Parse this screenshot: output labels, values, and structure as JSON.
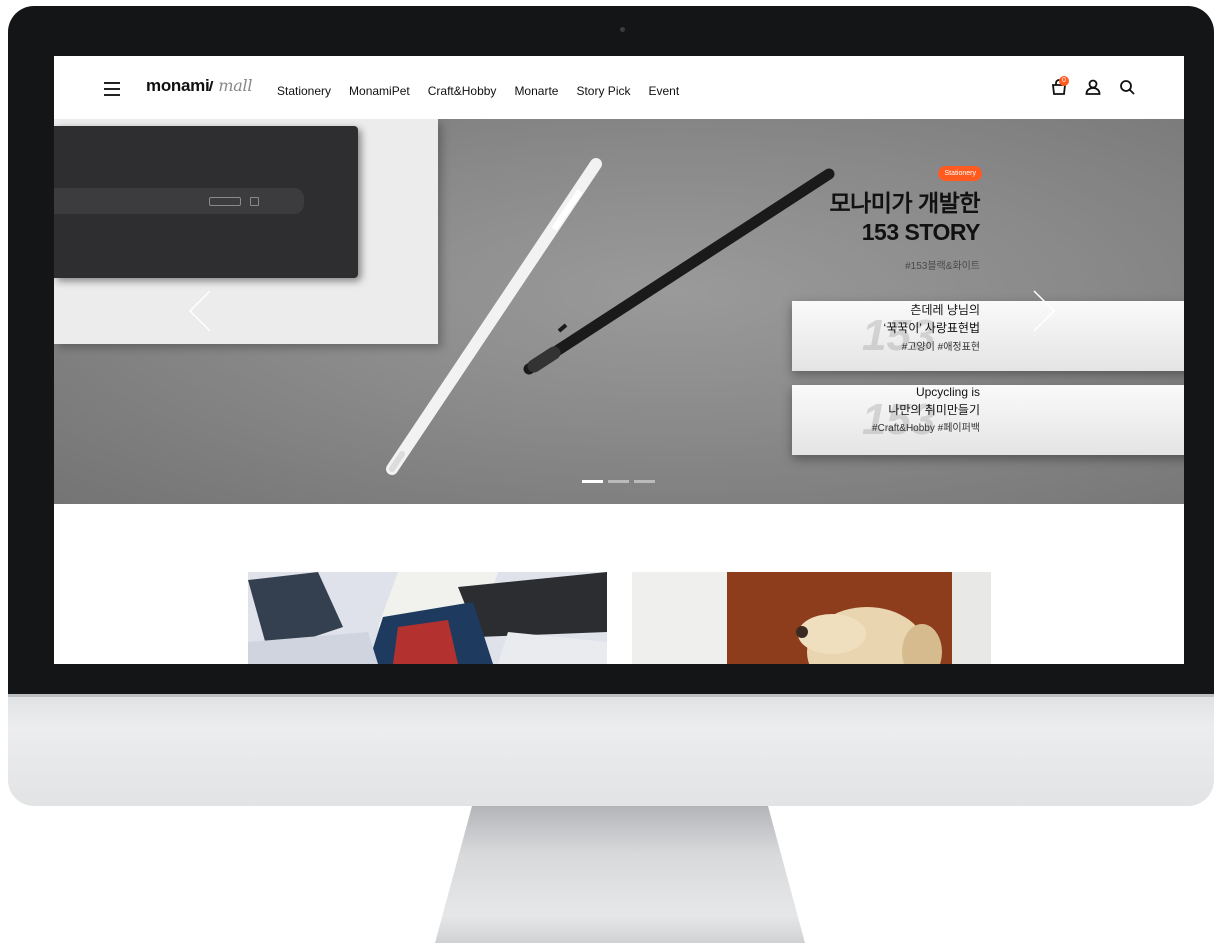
{
  "header": {
    "logo_brand": "monami",
    "logo_suffix": "mall",
    "menu": [
      {
        "label": "Stationery"
      },
      {
        "label": "MonamiPet"
      },
      {
        "label": "Craft&Hobby"
      },
      {
        "label": "Monarte"
      },
      {
        "label": "Story Pick"
      },
      {
        "label": "Event"
      }
    ],
    "cart_count": "0"
  },
  "hero": {
    "tag": "Stationery",
    "headline_line1": "모나미가 개발한",
    "headline_line2": "153 STORY",
    "hashtags": "#153블랙&화이트",
    "story2_line1": "츤데레 냥님의",
    "story2_line2": "‘꾹꾹이’ 사랑표현법",
    "story2_hashtags": "#고양이 #애정표현",
    "story3_line1": "Upcycling is",
    "story3_line2": "나만의 취미만들기",
    "story3_hashtags": "#Craft&Hobby #페이퍼백",
    "active_slide": 1,
    "slide_count": 3
  },
  "colors": {
    "accent": "#ff5a1f",
    "bezel": "#141517",
    "text": "#111111"
  },
  "icons": [
    "menu-icon",
    "cart-icon",
    "user-icon",
    "search-icon",
    "chevron-left-icon",
    "chevron-right-icon"
  ]
}
